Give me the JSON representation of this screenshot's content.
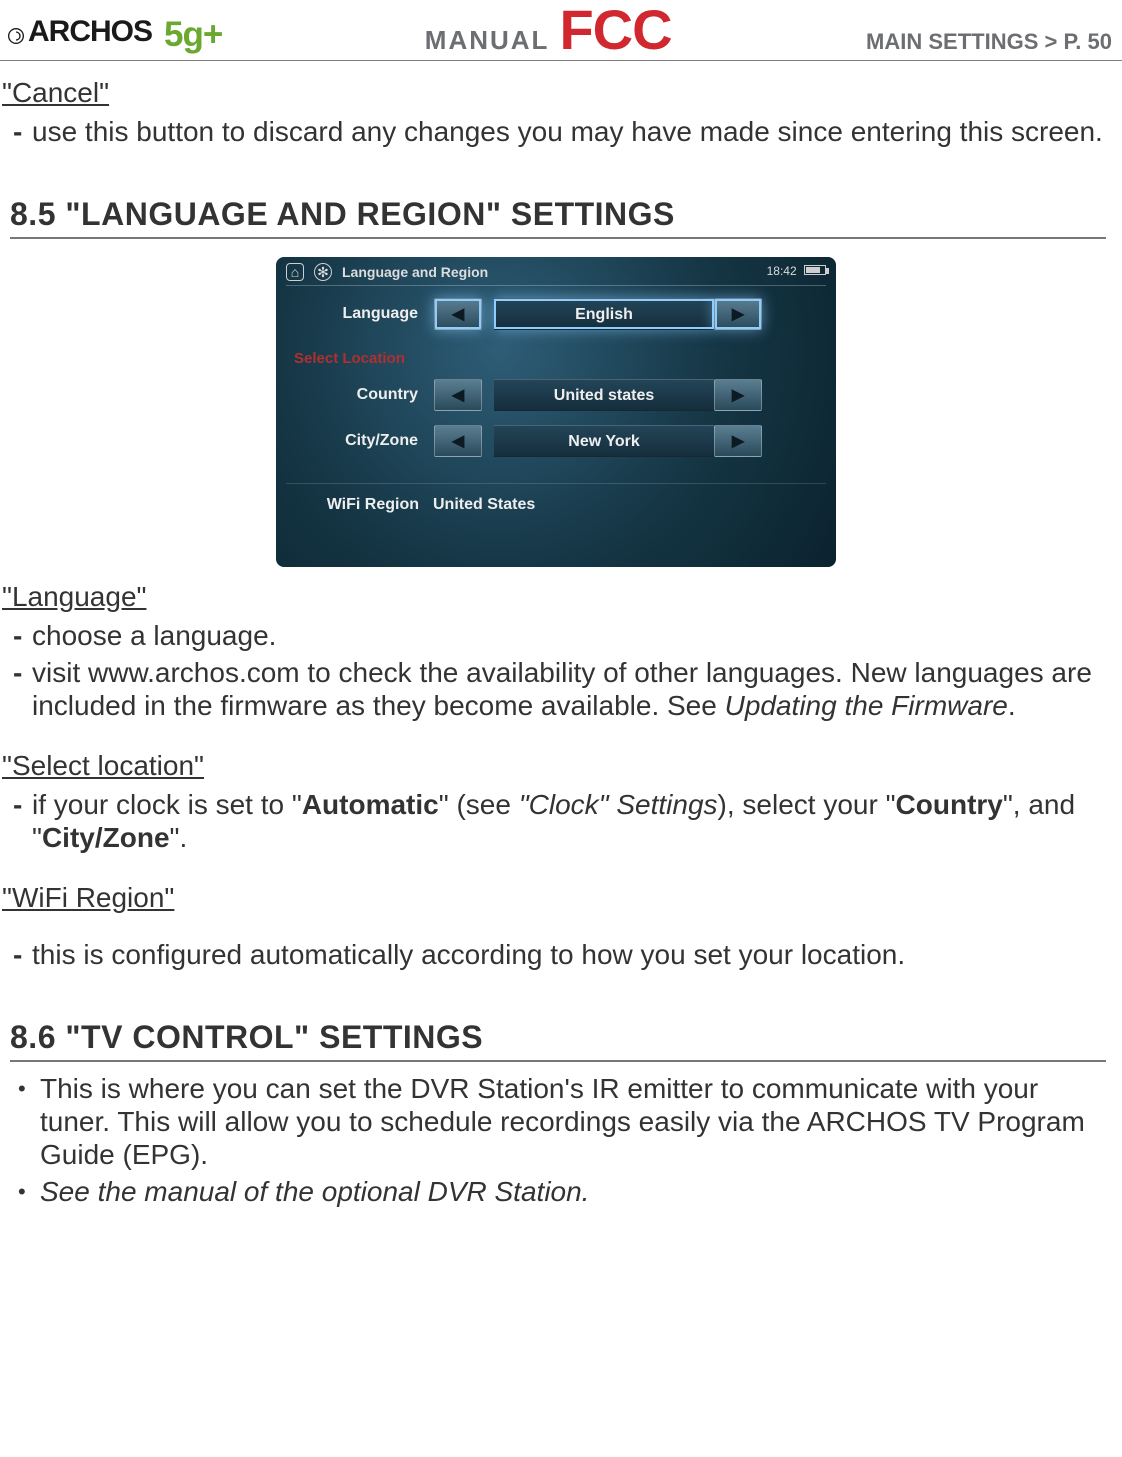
{
  "header": {
    "brand": "ARCHOS",
    "model": "5g+",
    "manual_label": "MANUAL",
    "fcc": "FCC",
    "right": "MAIN SETTINGS   >   P. 50"
  },
  "cancel": {
    "term": "\"Cancel\"",
    "bullet1": "use this button to discard any changes you may have made since entering this screen."
  },
  "sec85": {
    "heading": "8.5 \"Language and Region\" Settings"
  },
  "screenshot": {
    "title": "Language and Region",
    "time": "18:42",
    "language_label": "Language",
    "language_value": "English",
    "select_location_label": "Select Location",
    "country_label": "Country",
    "country_value": "United states",
    "city_label": "City/Zone",
    "city_value": "New York",
    "wifi_label": "WiFi Region",
    "wifi_value": "United States"
  },
  "language": {
    "term": "\"Language\"",
    "b1": "choose a language.",
    "b2_prefix": "visit www.archos.com to check the availability of other languages. New languages are included in the firmware as they become available. See ",
    "b2_italic": "Updating the Firmware",
    "b2_suffix": "."
  },
  "select_location": {
    "term": "\"Select location\"",
    "b1_p1": "if your clock is set to \"",
    "b1_bold1": "Automatic",
    "b1_p2": "\" (see ",
    "b1_italic": "\"Clock\" Settings",
    "b1_p3": "), select your \"",
    "b1_bold2": "Country",
    "b1_p4": "\", and \"",
    "b1_bold3": "City/Zone",
    "b1_p5": "\"."
  },
  "wifi_region": {
    "term": "\"WiFi Region\"",
    "b1": "this is configured automatically according to how you set your location."
  },
  "sec86": {
    "heading": "8.6 \"TV control\" Settings",
    "d1": "This is where you can set the DVR Station's IR emitter to communicate with your tuner. This will allow you to schedule recordings easily via the ARCHOS TV Program Guide (EPG).",
    "d2": "See the manual of the optional DVR Station."
  }
}
